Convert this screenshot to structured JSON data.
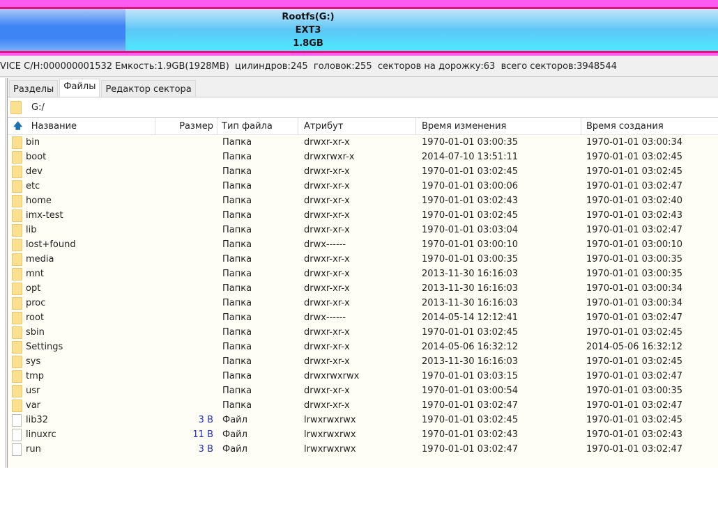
{
  "disk": {
    "partition": {
      "name": "Rootfs(G:)",
      "fs": "EXT3",
      "size": "1.8GB"
    },
    "colors": {
      "border": "#e0147a",
      "outer": "#ff5bf0",
      "partition0": "#3f84f5",
      "partition1": "#5cc7f6"
    }
  },
  "info": "VICE C/H:000000001532 Емкость:1.9GB(1928MB)  цилиндров:245  головок:255  секторов на дорожку:63  всего секторов:3948544",
  "tabs": [
    {
      "label": "Разделы"
    },
    {
      "label": "Файлы",
      "active": true
    },
    {
      "label": "Редактор сектора"
    }
  ],
  "path": "G:/",
  "columns": [
    "Название",
    "Размер",
    "Тип файла",
    "Атрибут",
    "Время изменения",
    "Время создания"
  ],
  "rows": [
    [
      "bin",
      "",
      "Папка",
      "drwxr-xr-x",
      "1970-01-01 03:00:35",
      "1970-01-01 03:00:34",
      "folder"
    ],
    [
      "boot",
      "",
      "Папка",
      "drwxrwxr-x",
      "2014-07-10 13:51:11",
      "1970-01-01 03:02:45",
      "folder"
    ],
    [
      "dev",
      "",
      "Папка",
      "drwxr-xr-x",
      "1970-01-01 03:02:45",
      "1970-01-01 03:02:45",
      "folder"
    ],
    [
      "etc",
      "",
      "Папка",
      "drwxr-xr-x",
      "1970-01-01 03:00:06",
      "1970-01-01 03:02:47",
      "folder"
    ],
    [
      "home",
      "",
      "Папка",
      "drwxr-xr-x",
      "1970-01-01 03:02:43",
      "1970-01-01 03:02:40",
      "folder"
    ],
    [
      "imx-test",
      "",
      "Папка",
      "drwxr-xr-x",
      "1970-01-01 03:02:45",
      "1970-01-01 03:02:43",
      "folder"
    ],
    [
      "lib",
      "",
      "Папка",
      "drwxr-xr-x",
      "1970-01-01 03:03:04",
      "1970-01-01 03:02:47",
      "folder"
    ],
    [
      "lost+found",
      "",
      "Папка",
      "drwx------",
      "1970-01-01 03:00:10",
      "1970-01-01 03:00:10",
      "folder"
    ],
    [
      "media",
      "",
      "Папка",
      "drwxr-xr-x",
      "1970-01-01 03:00:35",
      "1970-01-01 03:00:35",
      "folder"
    ],
    [
      "mnt",
      "",
      "Папка",
      "drwxr-xr-x",
      "2013-11-30 16:16:03",
      "1970-01-01 03:00:35",
      "folder"
    ],
    [
      "opt",
      "",
      "Папка",
      "drwxr-xr-x",
      "2013-11-30 16:16:03",
      "1970-01-01 03:00:34",
      "folder"
    ],
    [
      "proc",
      "",
      "Папка",
      "drwxr-xr-x",
      "2013-11-30 16:16:03",
      "1970-01-01 03:00:34",
      "folder"
    ],
    [
      "root",
      "",
      "Папка",
      "drwx------",
      "2014-05-14 12:12:41",
      "1970-01-01 03:02:47",
      "folder"
    ],
    [
      "sbin",
      "",
      "Папка",
      "drwxr-xr-x",
      "1970-01-01 03:02:45",
      "1970-01-01 03:02:45",
      "folder"
    ],
    [
      "Settings",
      "",
      "Папка",
      "drwxr-xr-x",
      "2014-05-06 16:32:12",
      "2014-05-06 16:32:12",
      "folder"
    ],
    [
      "sys",
      "",
      "Папка",
      "drwxr-xr-x",
      "2013-11-30 16:16:03",
      "1970-01-01 03:02:45",
      "folder"
    ],
    [
      "tmp",
      "",
      "Папка",
      "drwxrwxrwx",
      "1970-01-01 03:03:15",
      "1970-01-01 03:02:47",
      "folder"
    ],
    [
      "usr",
      "",
      "Папка",
      "drwxr-xr-x",
      "1970-01-01 03:00:54",
      "1970-01-01 03:00:35",
      "folder"
    ],
    [
      "var",
      "",
      "Папка",
      "drwxr-xr-x",
      "1970-01-01 03:02:47",
      "1970-01-01 03:02:47",
      "folder"
    ],
    [
      "lib32",
      "3 B",
      "Файл",
      "lrwxrwxrwx",
      "1970-01-01 03:02:45",
      "1970-01-01 03:02:45",
      "file"
    ],
    [
      "linuxrc",
      "11 B",
      "Файл",
      "lrwxrwxrwx",
      "1970-01-01 03:02:43",
      "1970-01-01 03:02:43",
      "file"
    ],
    [
      "run",
      "3 B",
      "Файл",
      "lrwxrwxrwx",
      "1970-01-01 03:02:47",
      "1970-01-01 03:02:47",
      "file"
    ]
  ]
}
